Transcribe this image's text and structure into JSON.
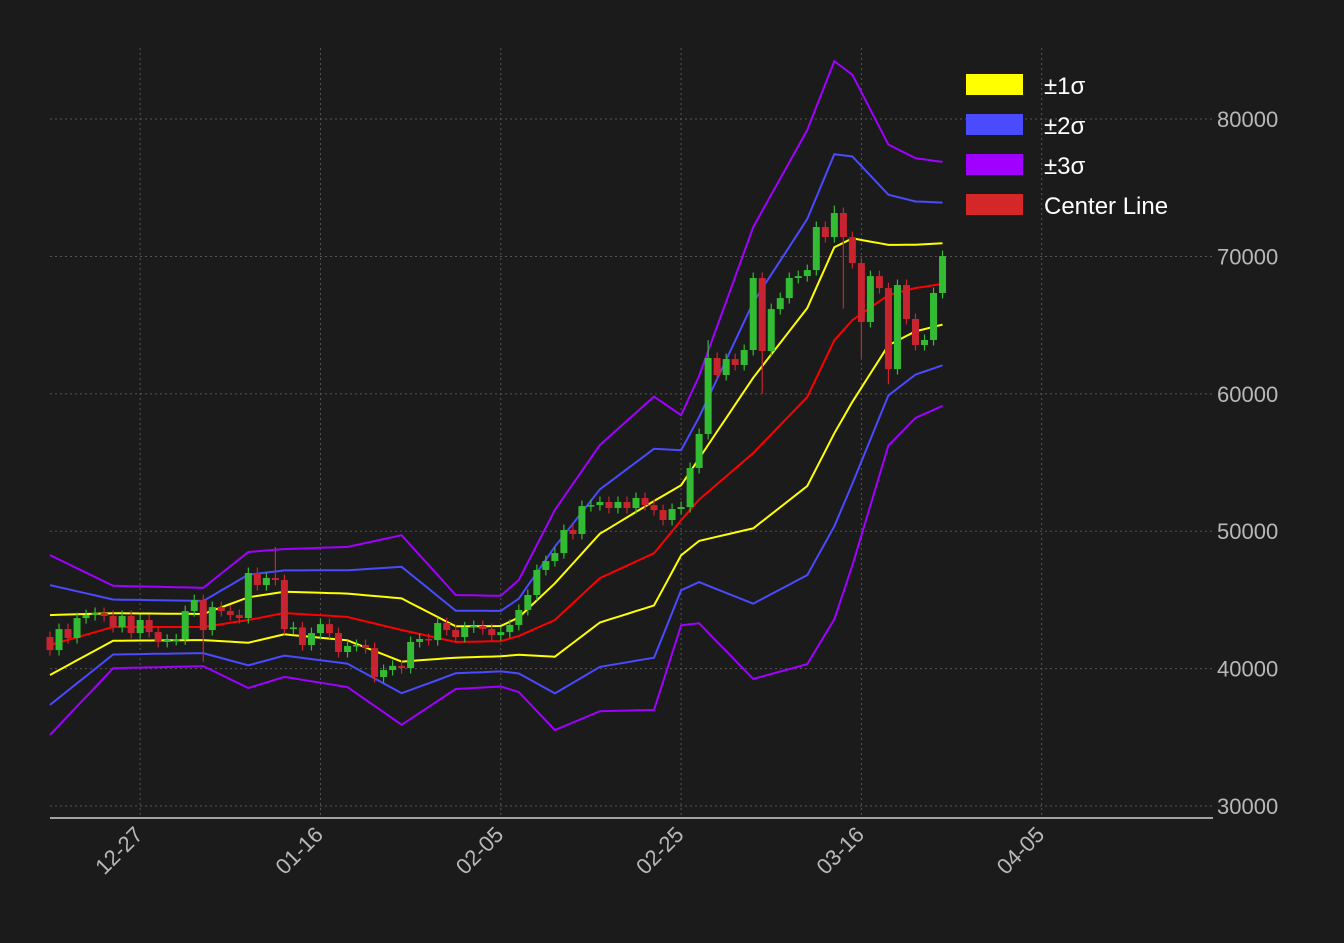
{
  "chart_data": {
    "type": "candlestick",
    "title": "",
    "xlabel": "",
    "ylabel": "",
    "start_date": "2023-12-17",
    "xlim_dates": [
      "2023-12-17",
      "2024-04-24"
    ],
    "ylim": [
      29130,
      85170
    ],
    "yticks": [
      30000,
      40000,
      50000,
      60000,
      70000,
      80000
    ],
    "xticks": [
      {
        "date": "2023-12-27",
        "label": "12-27"
      },
      {
        "date": "2024-01-16",
        "label": "01-16"
      },
      {
        "date": "2024-02-05",
        "label": "02-05"
      },
      {
        "date": "2024-02-25",
        "label": "02-25"
      },
      {
        "date": "2024-03-16",
        "label": "03-16"
      },
      {
        "date": "2024-04-05",
        "label": "04-05"
      }
    ],
    "grid": true,
    "first_open": 42300,
    "close": [
      41350,
      42880,
      42230,
      43680,
      43900,
      44050,
      43830,
      43030,
      43830,
      42590,
      43540,
      42660,
      41940,
      42100,
      42130,
      44190,
      44990,
      42810,
      44480,
      44190,
      43900,
      43680,
      46960,
      46080,
      46600,
      46450,
      42880,
      43000,
      41720,
      42590,
      43240,
      42590,
      41210,
      41650,
      41720,
      41500,
      39390,
      39900,
      40200,
      40040,
      41940,
      42160,
      42080,
      43320,
      42810,
      42300,
      43000,
      43100,
      42880,
      42440,
      42660,
      43180,
      44270,
      45360,
      47180,
      47830,
      48410,
      50090,
      49800,
      51830,
      51900,
      52130,
      51690,
      52130,
      51690,
      52420,
      51900,
      51540,
      50820,
      51620,
      51760,
      54600,
      57080,
      62610,
      61370,
      62530,
      62100,
      63190,
      68430,
      63120,
      66170,
      66970,
      68430,
      68570,
      69010,
      72140,
      71410,
      73160,
      71410,
      69520,
      65230,
      68570,
      67700,
      61800,
      67920,
      65450,
      63550,
      63920,
      67340,
      70030
    ],
    "typical_wick": 400,
    "wick_overrides": [
      {
        "day": 25,
        "high": 48850
      },
      {
        "day": 17,
        "low": 40500
      },
      {
        "day": 73,
        "high": 63900
      },
      {
        "day": 79,
        "low": 60000
      },
      {
        "day": 87,
        "high": 73700
      },
      {
        "day": 88,
        "low": 66200
      },
      {
        "day": 90,
        "low": 62600
      },
      {
        "day": 93,
        "low": 60700
      }
    ],
    "center_line": [
      [
        0,
        41720
      ],
      [
        7,
        43030
      ],
      [
        17,
        43030
      ],
      [
        22,
        43540
      ],
      [
        26,
        44050
      ],
      [
        33,
        43760
      ],
      [
        39,
        42810
      ],
      [
        45,
        41940
      ],
      [
        50,
        42000
      ],
      [
        52,
        42370
      ],
      [
        56,
        43540
      ],
      [
        61,
        46590
      ],
      [
        67,
        48400
      ],
      [
        70,
        50800
      ],
      [
        72,
        52300
      ],
      [
        78,
        55690
      ],
      [
        84,
        59770
      ],
      [
        87,
        63900
      ],
      [
        89,
        65370
      ],
      [
        93,
        67190
      ],
      [
        96,
        67700
      ],
      [
        99,
        68000
      ]
    ],
    "sigma": [
      [
        0,
        2180
      ],
      [
        7,
        1000
      ],
      [
        17,
        950
      ],
      [
        22,
        1650
      ],
      [
        26,
        1550
      ],
      [
        33,
        1700
      ],
      [
        39,
        2300
      ],
      [
        45,
        1140
      ],
      [
        50,
        1100
      ],
      [
        52,
        1360
      ],
      [
        56,
        2670
      ],
      [
        61,
        3230
      ],
      [
        67,
        3800
      ],
      [
        70,
        2550
      ],
      [
        72,
        3000
      ],
      [
        78,
        5480
      ],
      [
        84,
        6480
      ],
      [
        87,
        6770
      ],
      [
        89,
        5950
      ],
      [
        93,
        3650
      ],
      [
        96,
        3150
      ],
      [
        99,
        2960
      ]
    ],
    "legend_position": "top-right",
    "legend": [
      {
        "label": "±1σ",
        "color": "#ffff00",
        "k": 1
      },
      {
        "label": "±2σ",
        "color": "#4a4aff",
        "k": 2
      },
      {
        "label": "±3σ",
        "color": "#a000ff",
        "k": 3
      },
      {
        "label": "Center Line",
        "color": "#d62728",
        "line_color": "#ff0000"
      }
    ],
    "up_color": "#33bb33",
    "down_color": "#c8242f"
  }
}
